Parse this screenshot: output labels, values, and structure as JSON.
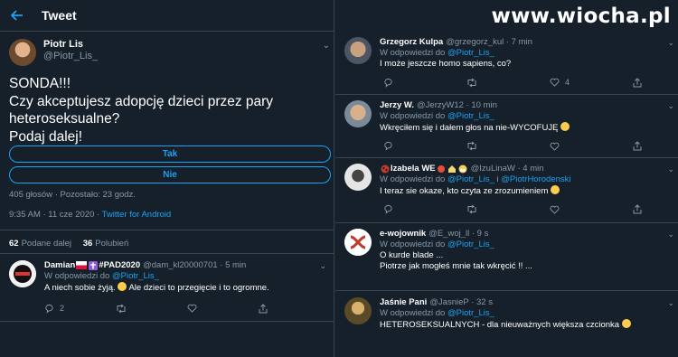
{
  "topbar": {
    "title": "Tweet"
  },
  "watermark": "www.wiocha.pl",
  "author": {
    "name": "Piotr Lis",
    "handle": "@Piotr_Lis_"
  },
  "tweet": {
    "text": "SONDA!!!\nCzy akceptujesz adopcję dzieci przez pary heteroseksualne?\nPodaj dalej!",
    "poll_options": [
      "Tak",
      "Nie"
    ],
    "poll_meta": "405 głosów · Pozostało: 23 godz.",
    "time": "9:35 AM · 11 cze 2020 · ",
    "client": "Twitter for Android",
    "retweets_count": "62",
    "retweets_label": "Podane dalej",
    "likes_count": "36",
    "likes_label": "Polubień"
  },
  "replies_left": [
    {
      "name": "Damian",
      "extra": "#PAD2020",
      "handle": "@dam_kl20000701 · 5 min",
      "in_reply_label": "W odpowiedzi do ",
      "in_reply_to": "@Piotr_Lis_",
      "text": "A niech sobie żyją.",
      "text2": "Ale dzieci to przegięcie i to ogromne.",
      "reply_count": "2",
      "retweet_count": "",
      "like_count": ""
    }
  ],
  "replies_right": [
    {
      "name": "Grzegorz Kulpa",
      "handle": "@grzegorz_kul · 7 min",
      "in_reply_label": "W odpowiedzi do ",
      "in_reply_to": "@Piotr_Lis_",
      "text": "I może jeszcze homo sapiens, co?",
      "like_count": "4"
    },
    {
      "name": "Jerzy W.",
      "handle": "@JerzyW12 · 10 min",
      "in_reply_label": "W odpowiedzi do ",
      "in_reply_to": "@Piotr_Lis_",
      "text": "Wkręciłem się i dałem głos na nie-WYCOFUJĘ",
      "like_count": ""
    },
    {
      "name": "Izabela WE",
      "handle": "@IzuLinaW · 4 min",
      "in_reply_label": "W odpowiedzi do ",
      "in_reply_to": "@Piotr_Lis_",
      "in_reply_and": " i ",
      "in_reply_to2": "@PiotrHorodenski",
      "text": "I teraz sie okaze, kto czyta ze zrozumieniem",
      "like_count": ""
    },
    {
      "name": "e-wojownik",
      "handle": "@E_woj_ll · 9 s",
      "in_reply_label": "W odpowiedzi do ",
      "in_reply_to": "@Piotr_Lis_",
      "text": "O kurde blade ...",
      "text2": "Piotrze jak mogłeś mnie tak wkręcić  !! ...",
      "like_count": ""
    },
    {
      "name": "Jaśnie Pani",
      "handle": "@JasnieP · 32 s",
      "in_reply_label": "W odpowiedzi do ",
      "in_reply_to": "@Piotr_Lis_",
      "text": "HETEROSEKSUALNYCH  - dla nieuważnych większa czcionka",
      "like_count": ""
    }
  ],
  "colors": {
    "bg": "#15202b",
    "accent": "#1da1f2",
    "muted": "#8899a6",
    "border": "#38444d"
  },
  "icons": [
    "back-arrow-icon",
    "chevron-down-icon",
    "reply-icon",
    "retweet-icon",
    "like-icon",
    "share-icon"
  ]
}
